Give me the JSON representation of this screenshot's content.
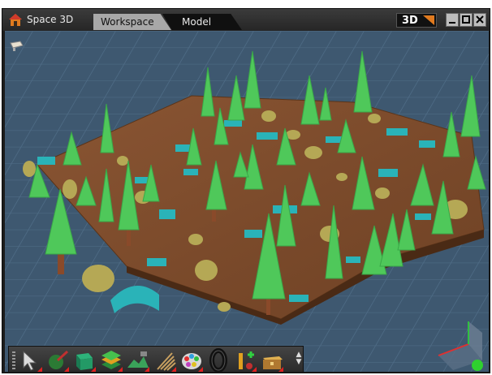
{
  "app": {
    "title": "Space 3D",
    "icon": "house-icon"
  },
  "tabs": [
    {
      "label": "Workspace",
      "active": true
    },
    {
      "label": "Model",
      "active": false
    }
  ],
  "view_mode": {
    "label": "3D"
  },
  "window_controls": [
    "minimize-icon",
    "maximize-icon",
    "close-icon"
  ],
  "viewport": {
    "camera_icon": "camera-icon",
    "axis_widget": "axis-gizmo-icon"
  },
  "toolbar": {
    "tools": [
      {
        "name": "select-tool",
        "icon": "arrow-cursor-icon"
      },
      {
        "name": "paint-tool",
        "icon": "paint-brush-icon"
      },
      {
        "name": "box-tool",
        "icon": "box-icon"
      },
      {
        "name": "layer-tool",
        "icon": "layers-icon"
      },
      {
        "name": "terrain-tool",
        "icon": "terrain-icon"
      },
      {
        "name": "rake-tool",
        "icon": "rake-icon"
      },
      {
        "name": "palette-tool",
        "icon": "palette-icon"
      },
      {
        "name": "ring-tool",
        "icon": "ring-icon"
      },
      {
        "name": "add-object-tool",
        "icon": "add-object-icon"
      },
      {
        "name": "chest-tool",
        "icon": "chest-icon"
      }
    ]
  },
  "colors": {
    "floor": "#3e5870",
    "terrain": "#7a4a2a",
    "tree": "#4fc85a",
    "rock": "#b5a855",
    "arch": "#2ab3b8",
    "accent": "#e07a1f"
  }
}
